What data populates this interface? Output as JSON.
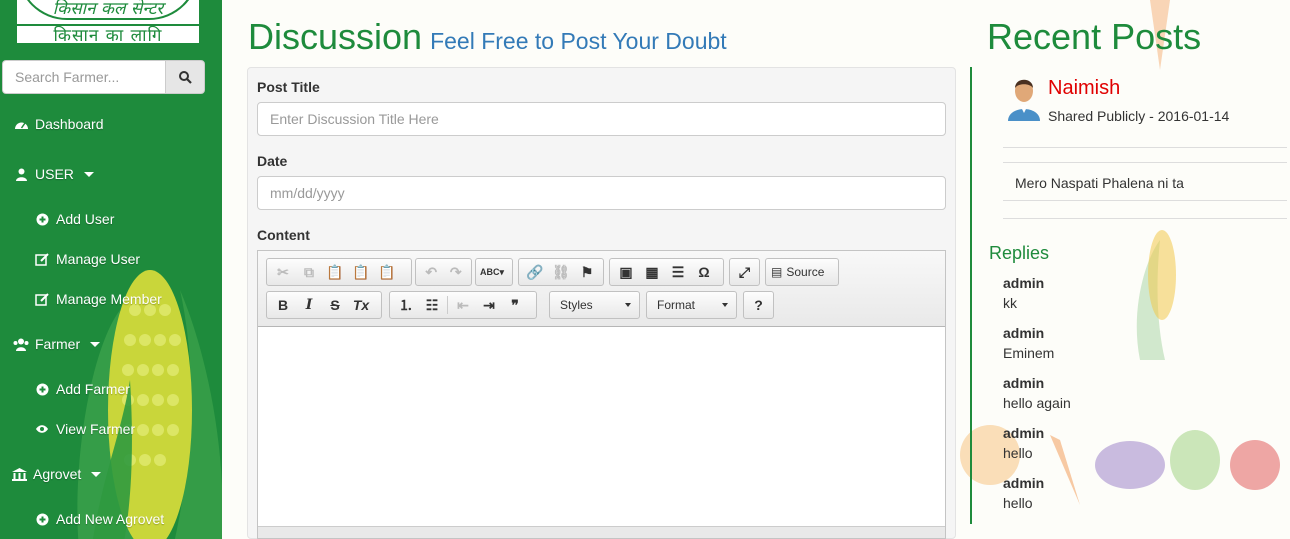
{
  "brand": {
    "logo_line1": "किसान कल सेन्टर",
    "logo_line2": "किसान का लागि"
  },
  "search": {
    "placeholder": "Search Farmer..."
  },
  "sidebar": {
    "items": [
      {
        "label": "Dashboard",
        "icon": "dashboard-icon"
      },
      {
        "label": "USER",
        "icon": "user-icon"
      },
      {
        "label": "Add User",
        "icon": "plus-circle-icon"
      },
      {
        "label": "Manage User",
        "icon": "edit-icon"
      },
      {
        "label": "Manage Member",
        "icon": "edit-icon"
      },
      {
        "label": "Farmer",
        "icon": "users-icon"
      },
      {
        "label": "Add Farmer",
        "icon": "plus-circle-icon"
      },
      {
        "label": "View Farmer",
        "icon": "eye-icon"
      },
      {
        "label": "Agrovet",
        "icon": "bank-icon"
      },
      {
        "label": "Add New Agrovet",
        "icon": "plus-circle-icon"
      }
    ]
  },
  "main": {
    "title": "Discussion",
    "subtitle": "Feel Free to Post Your Doubt",
    "form": {
      "post_title_label": "Post Title",
      "post_title_placeholder": "Enter Discussion Title Here",
      "date_label": "Date",
      "date_placeholder": "mm/dd/yyyy",
      "content_label": "Content"
    },
    "editor": {
      "source_label": "Source",
      "styles_label": "Styles",
      "format_label": "Format",
      "help_label": "?"
    }
  },
  "recent": {
    "title": "Recent Posts",
    "post": {
      "author": "Naimish",
      "meta": "Shared Publicly - 2016-01-14",
      "content": "Mero Naspati Phalena ni ta"
    },
    "replies_title": "Replies",
    "replies": [
      {
        "user": "admin",
        "text": "kk"
      },
      {
        "user": "admin",
        "text": "Eminem"
      },
      {
        "user": "admin",
        "text": "hello again"
      },
      {
        "user": "admin",
        "text": "hello"
      },
      {
        "user": "admin",
        "text": "hello"
      }
    ]
  },
  "colors": {
    "sidebar_green": "#1e8b3c",
    "heading_green": "#1e8b3c",
    "subtitle_blue": "#337ab7",
    "author_red": "#e00000"
  }
}
